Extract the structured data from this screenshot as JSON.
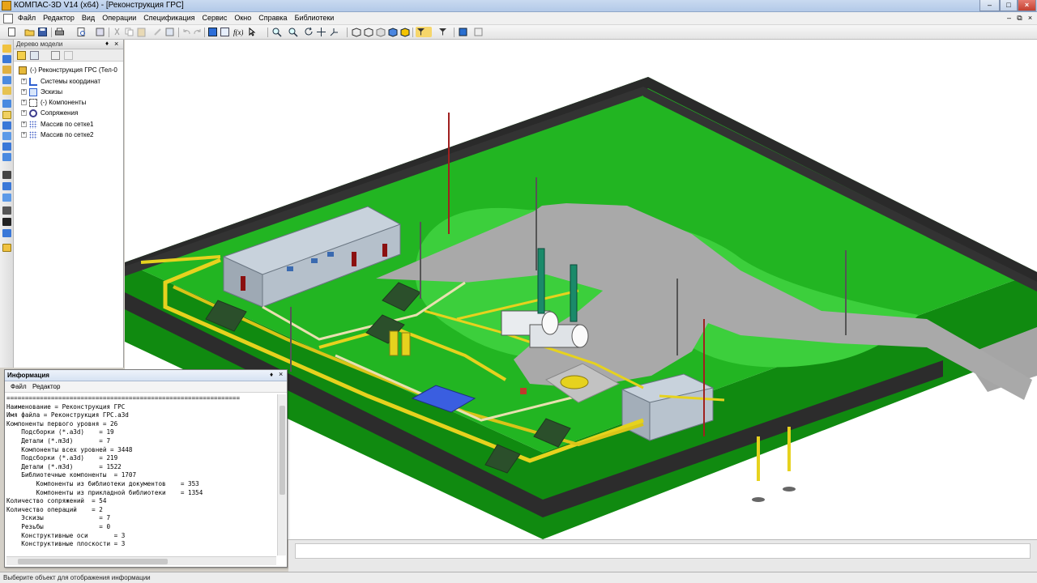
{
  "window": {
    "title": "КОМПАС-3D V14 (x64) - [Реконструкция ГРС]"
  },
  "menu": {
    "items": [
      "Файл",
      "Редактор",
      "Вид",
      "Операции",
      "Спецификация",
      "Сервис",
      "Окно",
      "Справка",
      "Библиотеки"
    ]
  },
  "tree_panel": {
    "title": "Дерево модели",
    "nodes": [
      {
        "label": "(-) Реконструкция ГРС (Тел-0",
        "expander": ""
      },
      {
        "label": "Системы координат",
        "expander": "+"
      },
      {
        "label": "Эскизы",
        "expander": "+"
      },
      {
        "label": "(-) Компоненты",
        "expander": "+"
      },
      {
        "label": "Сопряжения",
        "expander": "+"
      },
      {
        "label": "Массив по сетке1",
        "expander": "+"
      },
      {
        "label": "Массив по сетке2",
        "expander": "+"
      }
    ]
  },
  "info_panel": {
    "title": "Информация",
    "menu": [
      "Файл",
      "Редактор"
    ],
    "lines": [
      "===============================================================",
      "Наименование = Реконструкция ГРС",
      "Имя файла = Реконструкция ГРС.a3d",
      "Компоненты первого уровня = 26",
      "    Подсборки (*.a3d)    = 19",
      "    Детали (*.m3d)       = 7",
      "    Компоненты всех уровней = 3448",
      "    Подсборки (*.a3d)    = 219",
      "    Детали (*.m3d)       = 1522",
      "    Библиотечные компоненты  = 1707",
      "        Компоненты из библиотеки документов    = 353",
      "        Компоненты из прикладной библиотеки    = 1354",
      "Количество сопряжений  = 54",
      "Количество операций    = 2",
      "    Эскизы               = 7",
      "    Резьбы               = 0",
      "    Конструктивные оси       = 3",
      "    Конструктивные плоскости = 3"
    ]
  },
  "status": {
    "text": "Выберите объект для отображения информации"
  },
  "colors": {
    "ground": "#22b522",
    "lawn": "#3fcf3f",
    "pavement": "#a8a8a8",
    "fence": "#2e2e2e",
    "pipe": "#e6d21e",
    "building": "#c9d3dc",
    "roof": "#3a5ee0"
  },
  "icons": {
    "app": "kompas-logo-icon",
    "toolbar": [
      "new-doc-icon",
      "open-icon",
      "save-icon",
      "print-icon",
      "cut-icon",
      "copy-icon",
      "paste-icon",
      "undo-icon",
      "redo-icon",
      "zoom-icon",
      "rotate-icon",
      "pan-icon"
    ]
  }
}
